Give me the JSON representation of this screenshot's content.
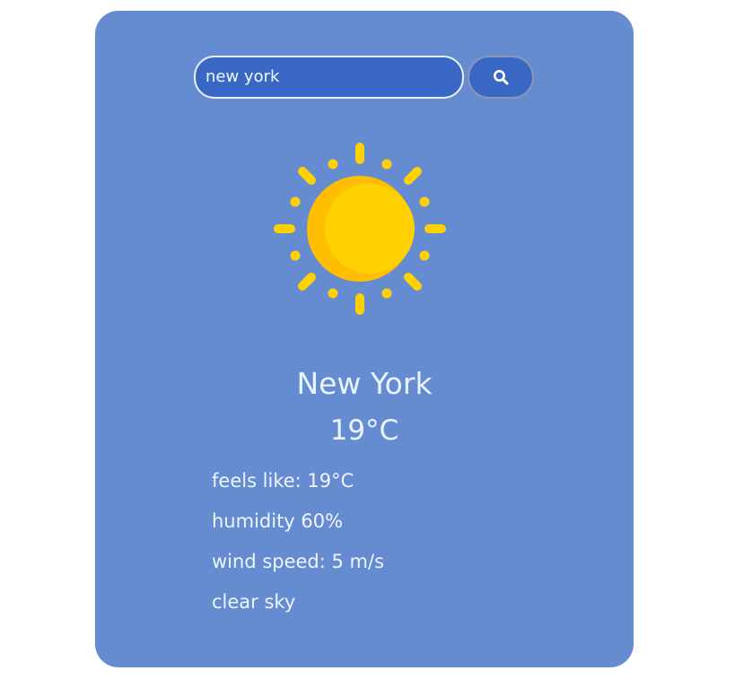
{
  "search": {
    "value": "new york",
    "button_icon": "search-icon"
  },
  "weather": {
    "icon": "sun-icon",
    "city": "New York",
    "temperature": "19°C",
    "feels_like": "feels like: 19°C",
    "humidity": "humidity 60%",
    "wind_speed": "wind speed: 5 m/s",
    "description": "clear sky"
  },
  "colors": {
    "card": "#658bd1",
    "input": "#3868c4",
    "sun": "#ffd100",
    "sun_shadow": "#ffbf00",
    "text": "#eaf4ff"
  }
}
